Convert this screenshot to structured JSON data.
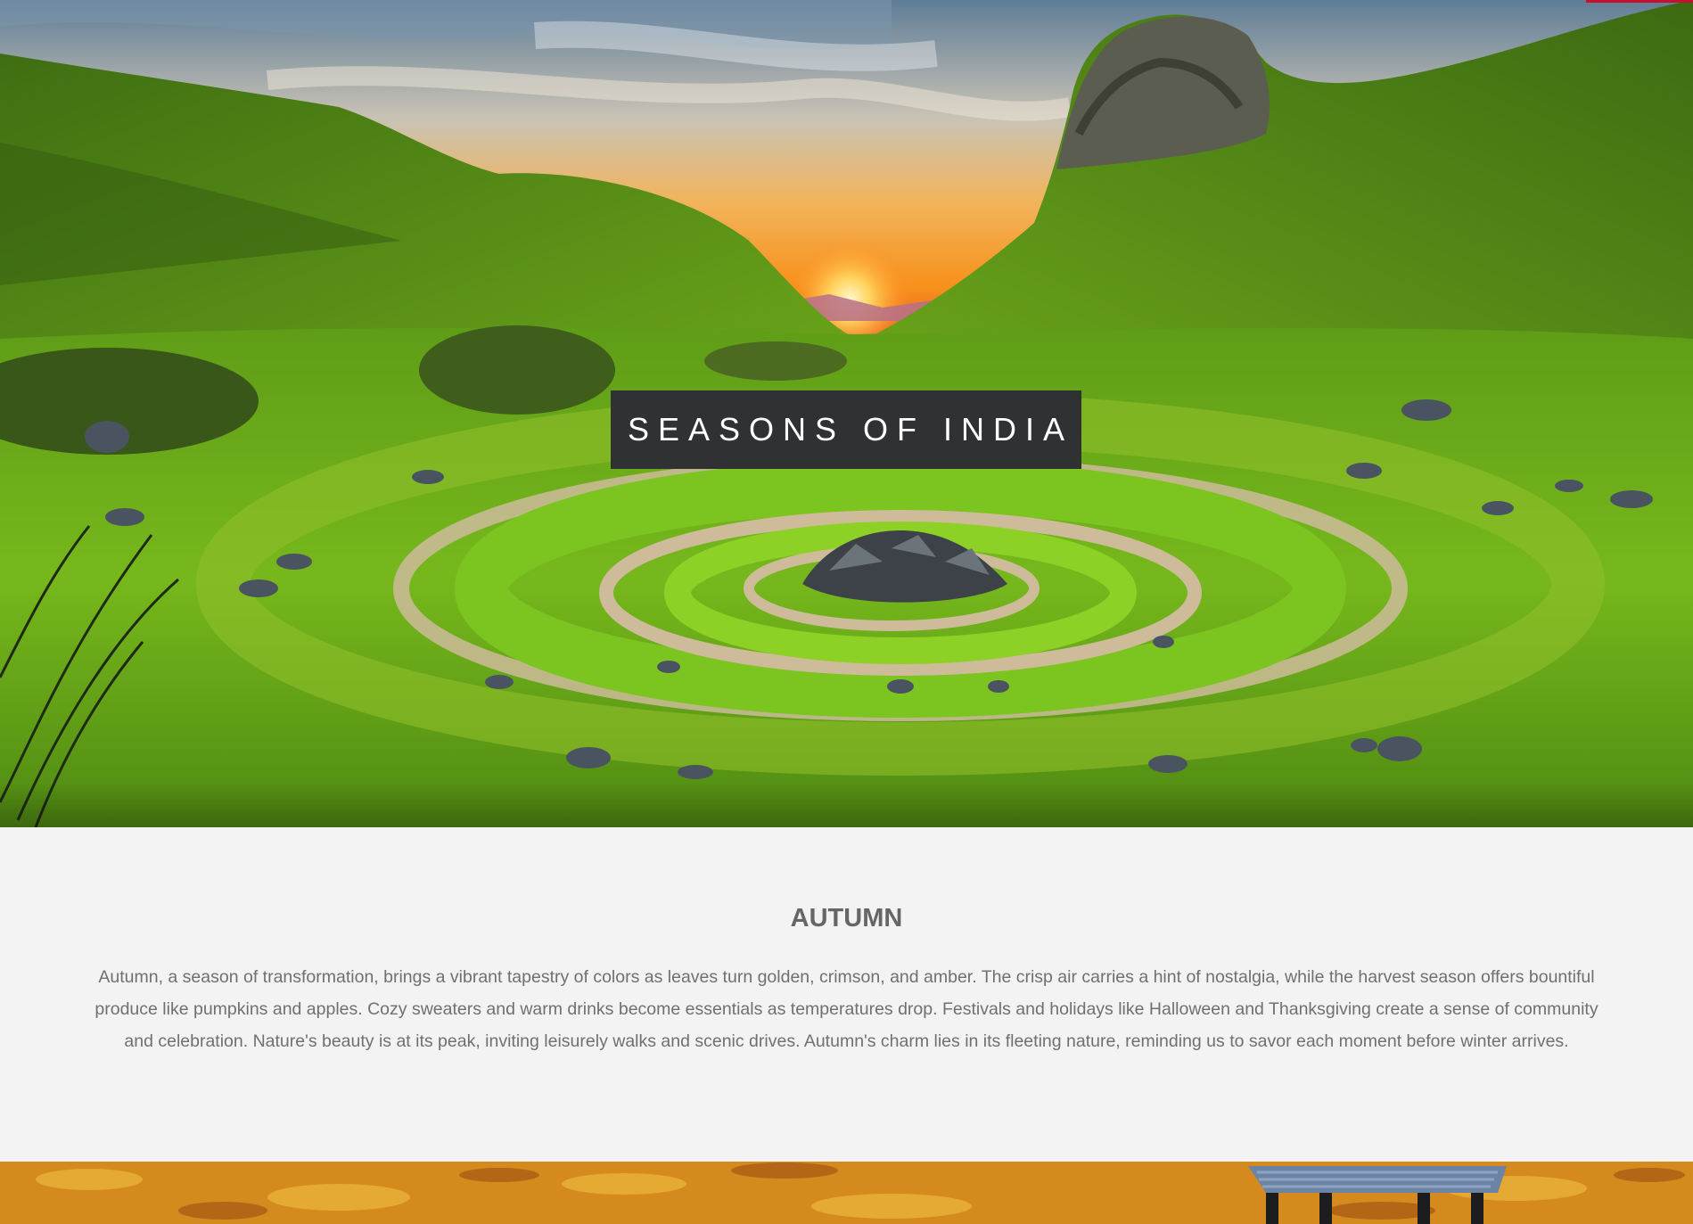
{
  "hero": {
    "title": "SEASONS OF INDIA"
  },
  "section": {
    "heading": "AUTUMN",
    "body": "Autumn, a season of transformation, brings a vibrant tapestry of colors as leaves turn golden, crimson, and amber. The crisp air carries a hint of nostalgia, while the harvest season offers bountiful produce like pumpkins and apples. Cozy sweaters and warm drinks become essentials as temperatures drop. Festivals and holidays like Halloween and Thanksgiving create a sense of community and celebration. Nature's beauty is at its peak, inviting leisurely walks and scenic drives. Autumn's charm lies in its fleeting nature, reminding us to savor each moment before winter arrives."
  },
  "colors": {
    "title_box": "#2f3133",
    "page_background": "#f3f3f3",
    "heading_text": "#666666",
    "body_text": "#707070",
    "accent": "#c8102e"
  }
}
